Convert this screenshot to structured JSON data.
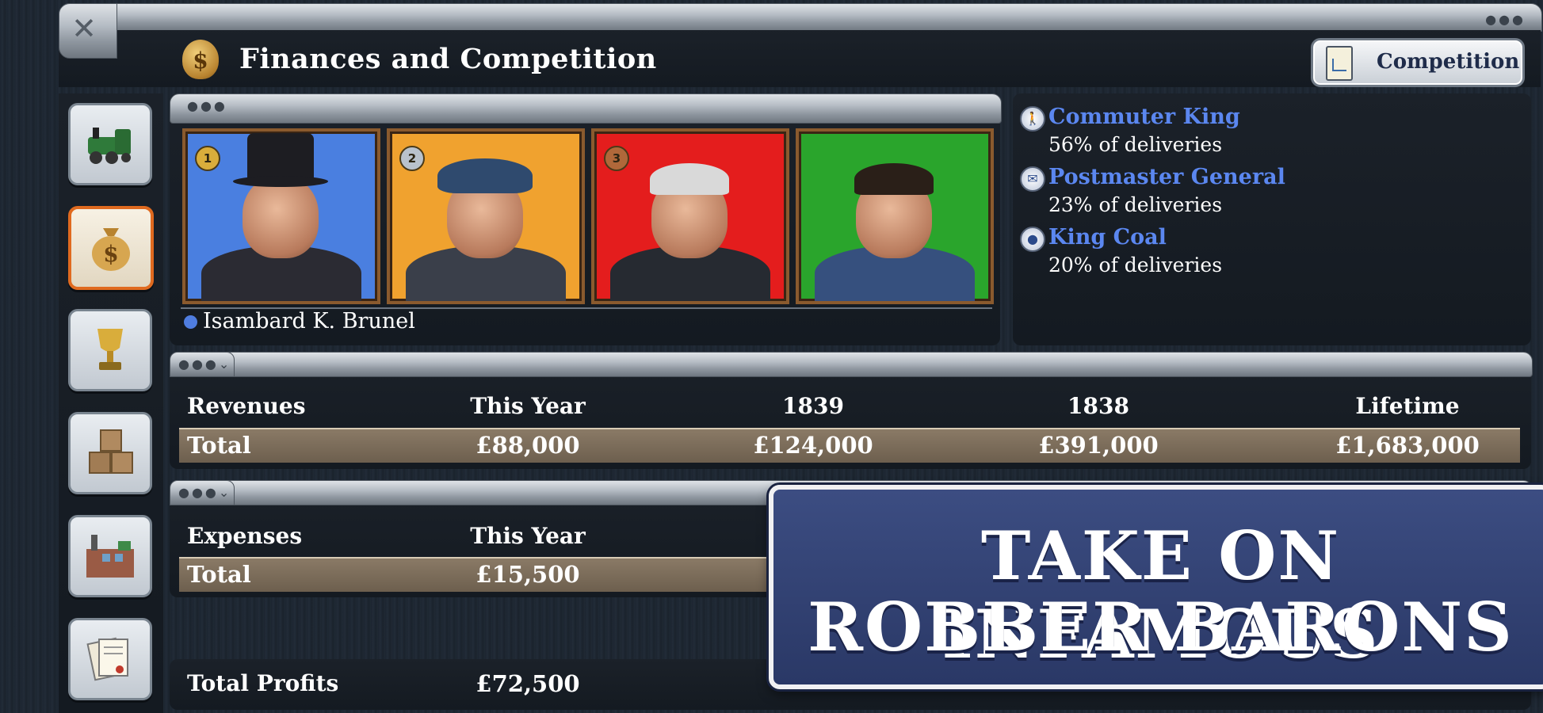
{
  "window": {
    "title": "Finances and Competition",
    "title_icon": "money-bag-icon",
    "close_icon": "close-icon"
  },
  "competition_button": {
    "label": "Competition",
    "icon": "clipboard-chart-icon"
  },
  "sidebar": {
    "items": [
      {
        "name": "trains",
        "icon": "locomotive-icon",
        "active": false
      },
      {
        "name": "finances",
        "icon": "money-bag-icon",
        "active": true
      },
      {
        "name": "awards",
        "icon": "trophy-icon",
        "active": false
      },
      {
        "name": "cargo",
        "icon": "crates-icon",
        "active": false
      },
      {
        "name": "industries",
        "icon": "factory-icon",
        "active": false
      },
      {
        "name": "reports",
        "icon": "documents-icon",
        "active": false
      }
    ]
  },
  "competitors": [
    {
      "rank": "1",
      "bg": "#4a7fe0",
      "medal": "#d9ad3b"
    },
    {
      "rank": "2",
      "bg": "#f0a22f",
      "medal": "#b9c2cc"
    },
    {
      "rank": "3",
      "bg": "#e41d1d",
      "medal": "#b0683a"
    },
    {
      "rank": "",
      "bg": "#2aa52c",
      "medal": ""
    }
  ],
  "selected_competitor": "Isambard K. Brunel",
  "awards": [
    {
      "title": "Commuter King",
      "detail": "56% of deliveries",
      "icon": "walking-person-icon"
    },
    {
      "title": "Postmaster General",
      "detail": "23% of deliveries",
      "icon": "envelope-icon"
    },
    {
      "title": "King Coal",
      "detail": "20% of deliveries",
      "icon": "coal-icon"
    }
  ],
  "revenues": {
    "headers": [
      "Revenues",
      "This Year",
      "1839",
      "1838",
      "Lifetime"
    ],
    "total_label": "Total",
    "total_values": [
      "£88,000",
      "£124,000",
      "£391,000",
      "£1,683,000"
    ]
  },
  "expenses": {
    "headers": [
      "Expenses",
      "This Year"
    ],
    "total_label": "Total",
    "total_values": [
      "£15,500"
    ]
  },
  "profits": {
    "label": "Total Profits",
    "values": [
      "£72,500"
    ]
  },
  "promo": {
    "line1": "TAKE ON INFAMOUS",
    "line2": "ROBBER BARONS"
  }
}
